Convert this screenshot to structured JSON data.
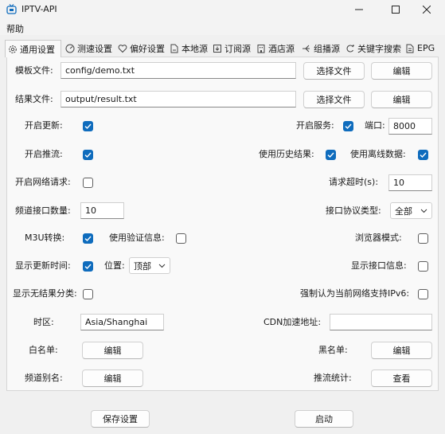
{
  "window": {
    "title": "IPTV-API",
    "app_icon": "tv-icon"
  },
  "menu": {
    "help": "帮助"
  },
  "tabs": [
    {
      "label": "通用设置",
      "icon": "gear-icon"
    },
    {
      "label": "测速设置",
      "icon": "speedometer-icon"
    },
    {
      "label": "偏好设置",
      "icon": "heart-icon"
    },
    {
      "label": "本地源",
      "icon": "local-file-icon"
    },
    {
      "label": "订阅源",
      "icon": "subscription-icon"
    },
    {
      "label": "酒店源",
      "icon": "hotel-icon"
    },
    {
      "label": "组播源",
      "icon": "multicast-icon"
    },
    {
      "label": "关键字搜索",
      "icon": "keyword-search-icon"
    },
    {
      "label": "EPG",
      "icon": "epg-icon"
    }
  ],
  "template_file": {
    "label": "模板文件:",
    "value": "config/demo.txt",
    "choose": "选择文件",
    "edit": "编辑"
  },
  "result_file": {
    "label": "结果文件:",
    "value": "output/result.txt",
    "choose": "选择文件",
    "edit": "编辑"
  },
  "open_update": {
    "label": "开启更新:",
    "checked": true
  },
  "open_service": {
    "label": "开启服务:",
    "checked": true
  },
  "port": {
    "label": "端口:",
    "value": "8000"
  },
  "open_push": {
    "label": "开启推流:",
    "checked": true
  },
  "use_history": {
    "label": "使用历史结果:",
    "checked": true
  },
  "use_offline": {
    "label": "使用离线数据:",
    "checked": true
  },
  "open_network_request": {
    "label": "开启网络请求:",
    "checked": false
  },
  "request_timeout": {
    "label": "请求超时(s):",
    "value": "10"
  },
  "channel_interface_count": {
    "label": "频道接口数量:",
    "value": "10"
  },
  "interface_protocol": {
    "label": "接口协议类型:",
    "value": "全部"
  },
  "m3u": {
    "label": "M3U转换:",
    "checked": true
  },
  "use_verification": {
    "label": "使用验证信息:",
    "checked": false
  },
  "browser_mode": {
    "label": "浏览器模式:",
    "checked": false
  },
  "show_update_time": {
    "label": "显示更新时间:",
    "checked": true
  },
  "position": {
    "label": "位置:",
    "value": "顶部"
  },
  "show_interface_info": {
    "label": "显示接口信息:",
    "checked": false
  },
  "show_unmatched_category": {
    "label": "显示无结果分类:",
    "checked": false
  },
  "force_ipv6": {
    "label": "强制认为当前网络支持IPv6:",
    "checked": false
  },
  "timezone": {
    "label": "时区:",
    "value": "Asia/Shanghai"
  },
  "cdn": {
    "label": "CDN加速地址:",
    "value": ""
  },
  "whitelist": {
    "label": "白名单:",
    "button": "编辑"
  },
  "blacklist": {
    "label": "黑名单:",
    "button": "编辑"
  },
  "channel_alias": {
    "label": "频道别名:",
    "button": "编辑"
  },
  "push_stats": {
    "label": "推流统计:",
    "button": "查看"
  },
  "footer": {
    "save": "保存设置",
    "start": "启动"
  },
  "colors": {
    "checkbox_checked": "#0f6cbd",
    "panel": "#f9f9f9",
    "window": "#f0f0f0"
  }
}
